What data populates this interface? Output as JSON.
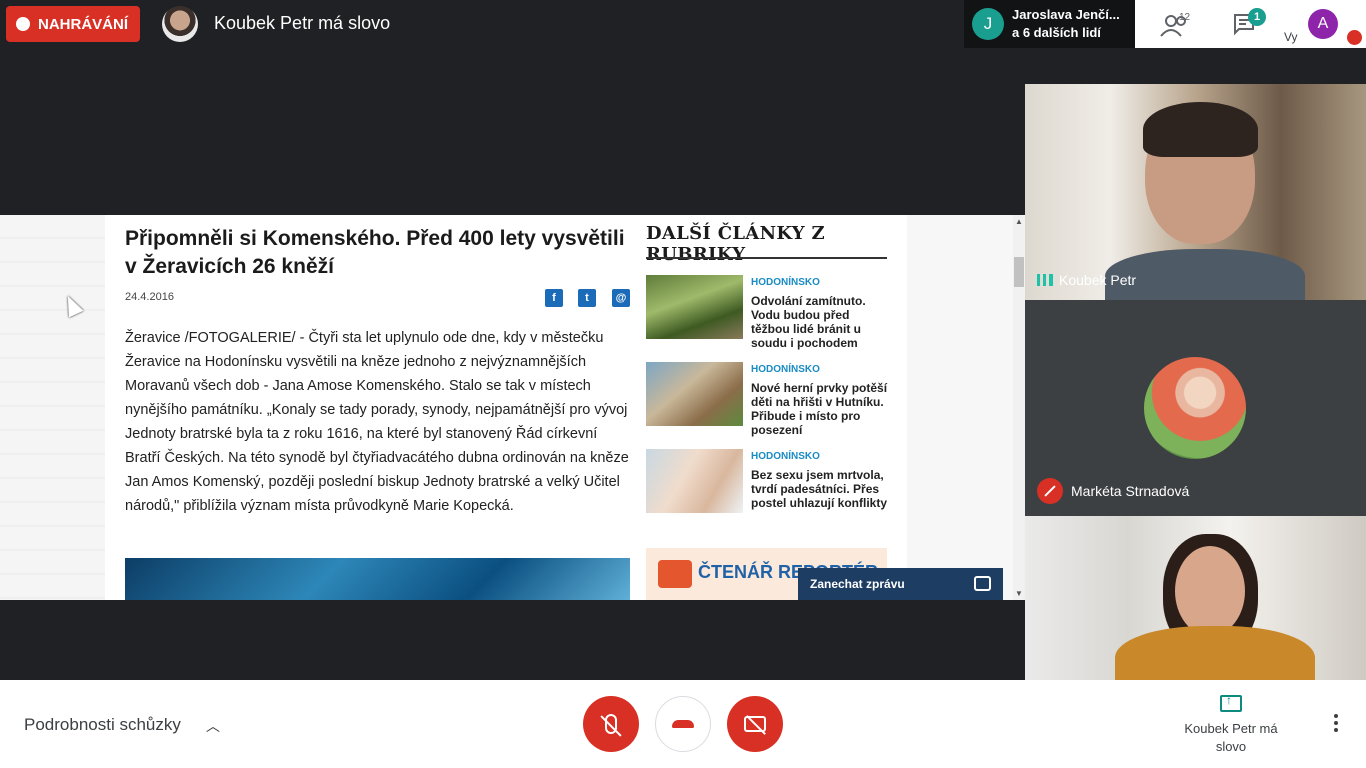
{
  "top": {
    "recording_label": "NAHRÁVÁNÍ",
    "presenter_title": "Koubek Petr má slovo",
    "participants_chip_letter": "J",
    "participants_chip_line1": "Jaroslava Jenčí...",
    "participants_chip_line2": "a 6 dalších lidí",
    "people_count": "12",
    "chat_unread": "1",
    "self_label": "Vy",
    "self_avatar_letter": "A"
  },
  "shared_screen": {
    "article_title": "Připomněli si Komenského. Před 400 lety vysvětili v Žeravicích 26 kněží",
    "article_date": "24.4.2016",
    "article_body": "Žeravice /FOTOGALERIE/ - Čtyři sta let uplynulo ode dne, kdy v městečku Žeravice na Hodonínsku vysvětili na kněze jednoho z nejvýznamnějších Moravanů všech dob - Jana Amose Komenského. Stalo se tak v místech nynějšího památníku. „Konaly se tady porady, synody, nejpamátnější pro vývoj Jednoty bratrské byla ta z roku 1616, na které byl stanovený Řád církevní Bratří Českých. Na této synodě byl čtyřiadvacátého dubna ordinován na kněze Jan Amos Komenský, později poslední biskup Jednoty bratrské a velký Učitel národů,\" přiblížila význam místa průvodkyně Marie Kopecká.",
    "rubric_title": "DALŠÍ ČLÁNKY Z RUBRIKY",
    "rubric_items": [
      {
        "category": "HODONÍNSKO",
        "headline": "Odvolání zamítnuto. Vodu budou před těžbou lidé bránit u soudu i pochodem"
      },
      {
        "category": "HODONÍNSKO",
        "headline": "Nové herní prvky potěší děti na hřišti v Hutníku. Přibude i místo pro posezení"
      },
      {
        "category": "HODONÍNSKO",
        "headline": "Bez sexu jsem mrtvola, tvrdí padesátníci. Přes postel uhlazují konflikty"
      }
    ],
    "reporter_banner": "ČTENÁŘ REPORTÉR",
    "leave_message": "Zanechat zprávu"
  },
  "tiles": {
    "tile1_name": "Koubek Petr",
    "tile2_name": "Markéta Strnadová"
  },
  "bottom": {
    "details_label": "Podrobnosti schůzky",
    "present_label": "Koubek Petr má slovo"
  },
  "colors": {
    "recording_red": "#d93025",
    "accent_teal": "#1a9e8f",
    "background": "#202124"
  }
}
